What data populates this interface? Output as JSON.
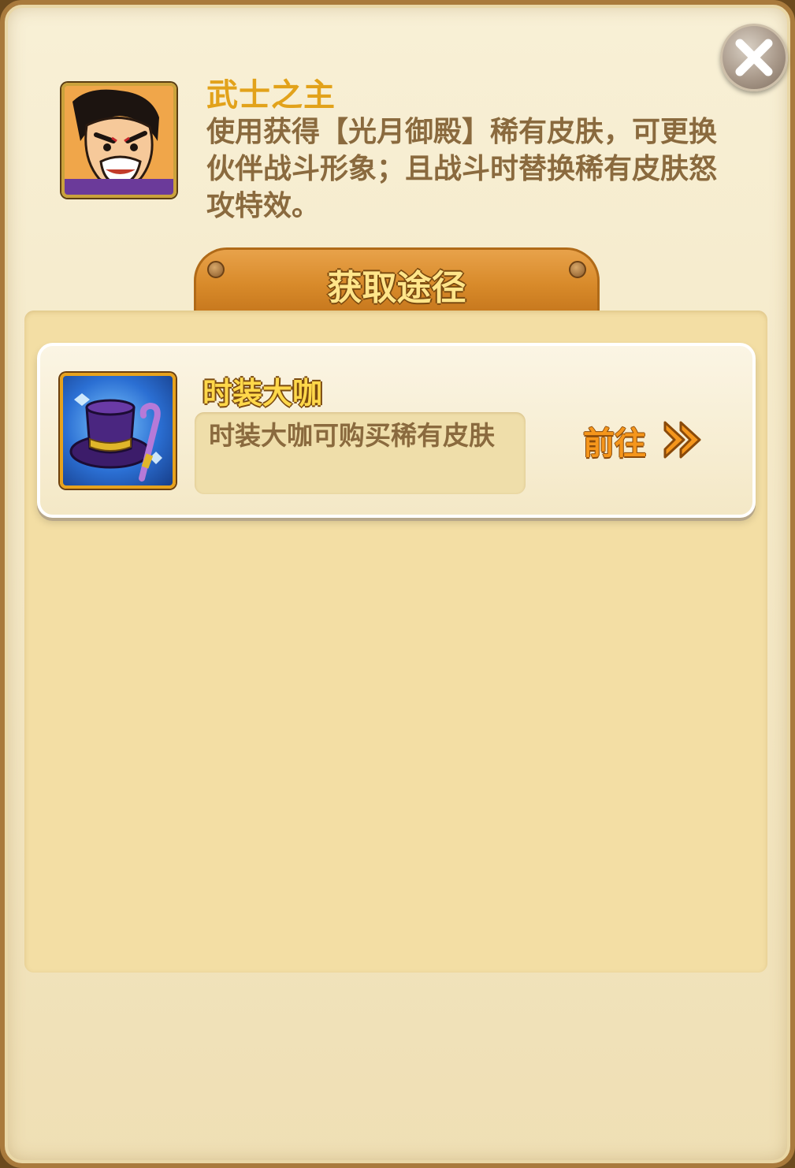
{
  "skin": {
    "title": "武士之主",
    "description": "使用获得【光月御殿】稀有皮肤，可更换伙伴战斗形象；且战斗时替换稀有皮肤怒攻特效。",
    "portrait_icon": "samurai-portrait-icon"
  },
  "section": {
    "title": "获取途径"
  },
  "sources": [
    {
      "name": "时装大咖",
      "description": "时装大咖可购买稀有皮肤",
      "icon": "top-hat-cane-icon",
      "goto_label": "前往"
    }
  ],
  "colors": {
    "title_gold": "#e2a21a",
    "body_text": "#8a6a3e",
    "tab_orange": "#d88a2a",
    "panel_bg": "#f3dea4",
    "goto_orange": "#f5961c"
  }
}
